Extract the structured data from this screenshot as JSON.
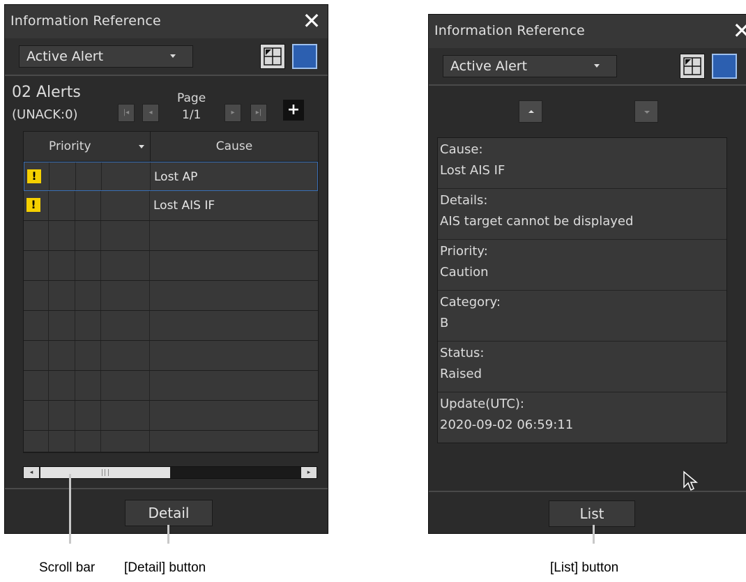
{
  "list_panel": {
    "title": "Information Reference",
    "dropdown": "Active Alert",
    "alerts_count": "02 Alerts",
    "unack": "(UNACK:0)",
    "page_label": "Page",
    "page_num": "1/1",
    "header_priority": "Priority",
    "header_cause": "Cause",
    "rows": [
      {
        "warning": "!",
        "cause": "Lost AP"
      },
      {
        "warning": "!",
        "cause": "Lost AIS IF"
      }
    ],
    "detail_button": "Detail"
  },
  "detail_panel": {
    "title": "Information Reference",
    "dropdown": "Active Alert",
    "fields": [
      {
        "label": "Cause:",
        "value": "Lost AIS IF"
      },
      {
        "label": "Details:",
        "value": "AIS target cannot be displayed"
      },
      {
        "label": "Priority:",
        "value": "Caution"
      },
      {
        "label": "Category:",
        "value": "B"
      },
      {
        "label": "Status:",
        "value": "Raised"
      },
      {
        "label": "Update(UTC):",
        "value": "2020-09-02 06:59:11"
      }
    ],
    "list_button": "List"
  },
  "callouts": {
    "scroll_bar": "Scroll bar",
    "detail_button": "[Detail] button",
    "list_button": "[List] button"
  },
  "colors": {
    "panel_bg": "#2b2b2b",
    "caution_yellow": "#f5d000",
    "window_blue": "#2c5fb0",
    "selection_border": "#3a6fb5"
  },
  "icons": [
    "close-icon",
    "restore-window-icon",
    "window-icon",
    "warning-icon",
    "first-page-icon",
    "prev-page-icon",
    "next-page-icon",
    "last-page-icon",
    "plus-icon",
    "mouse-cursor-icon"
  ]
}
